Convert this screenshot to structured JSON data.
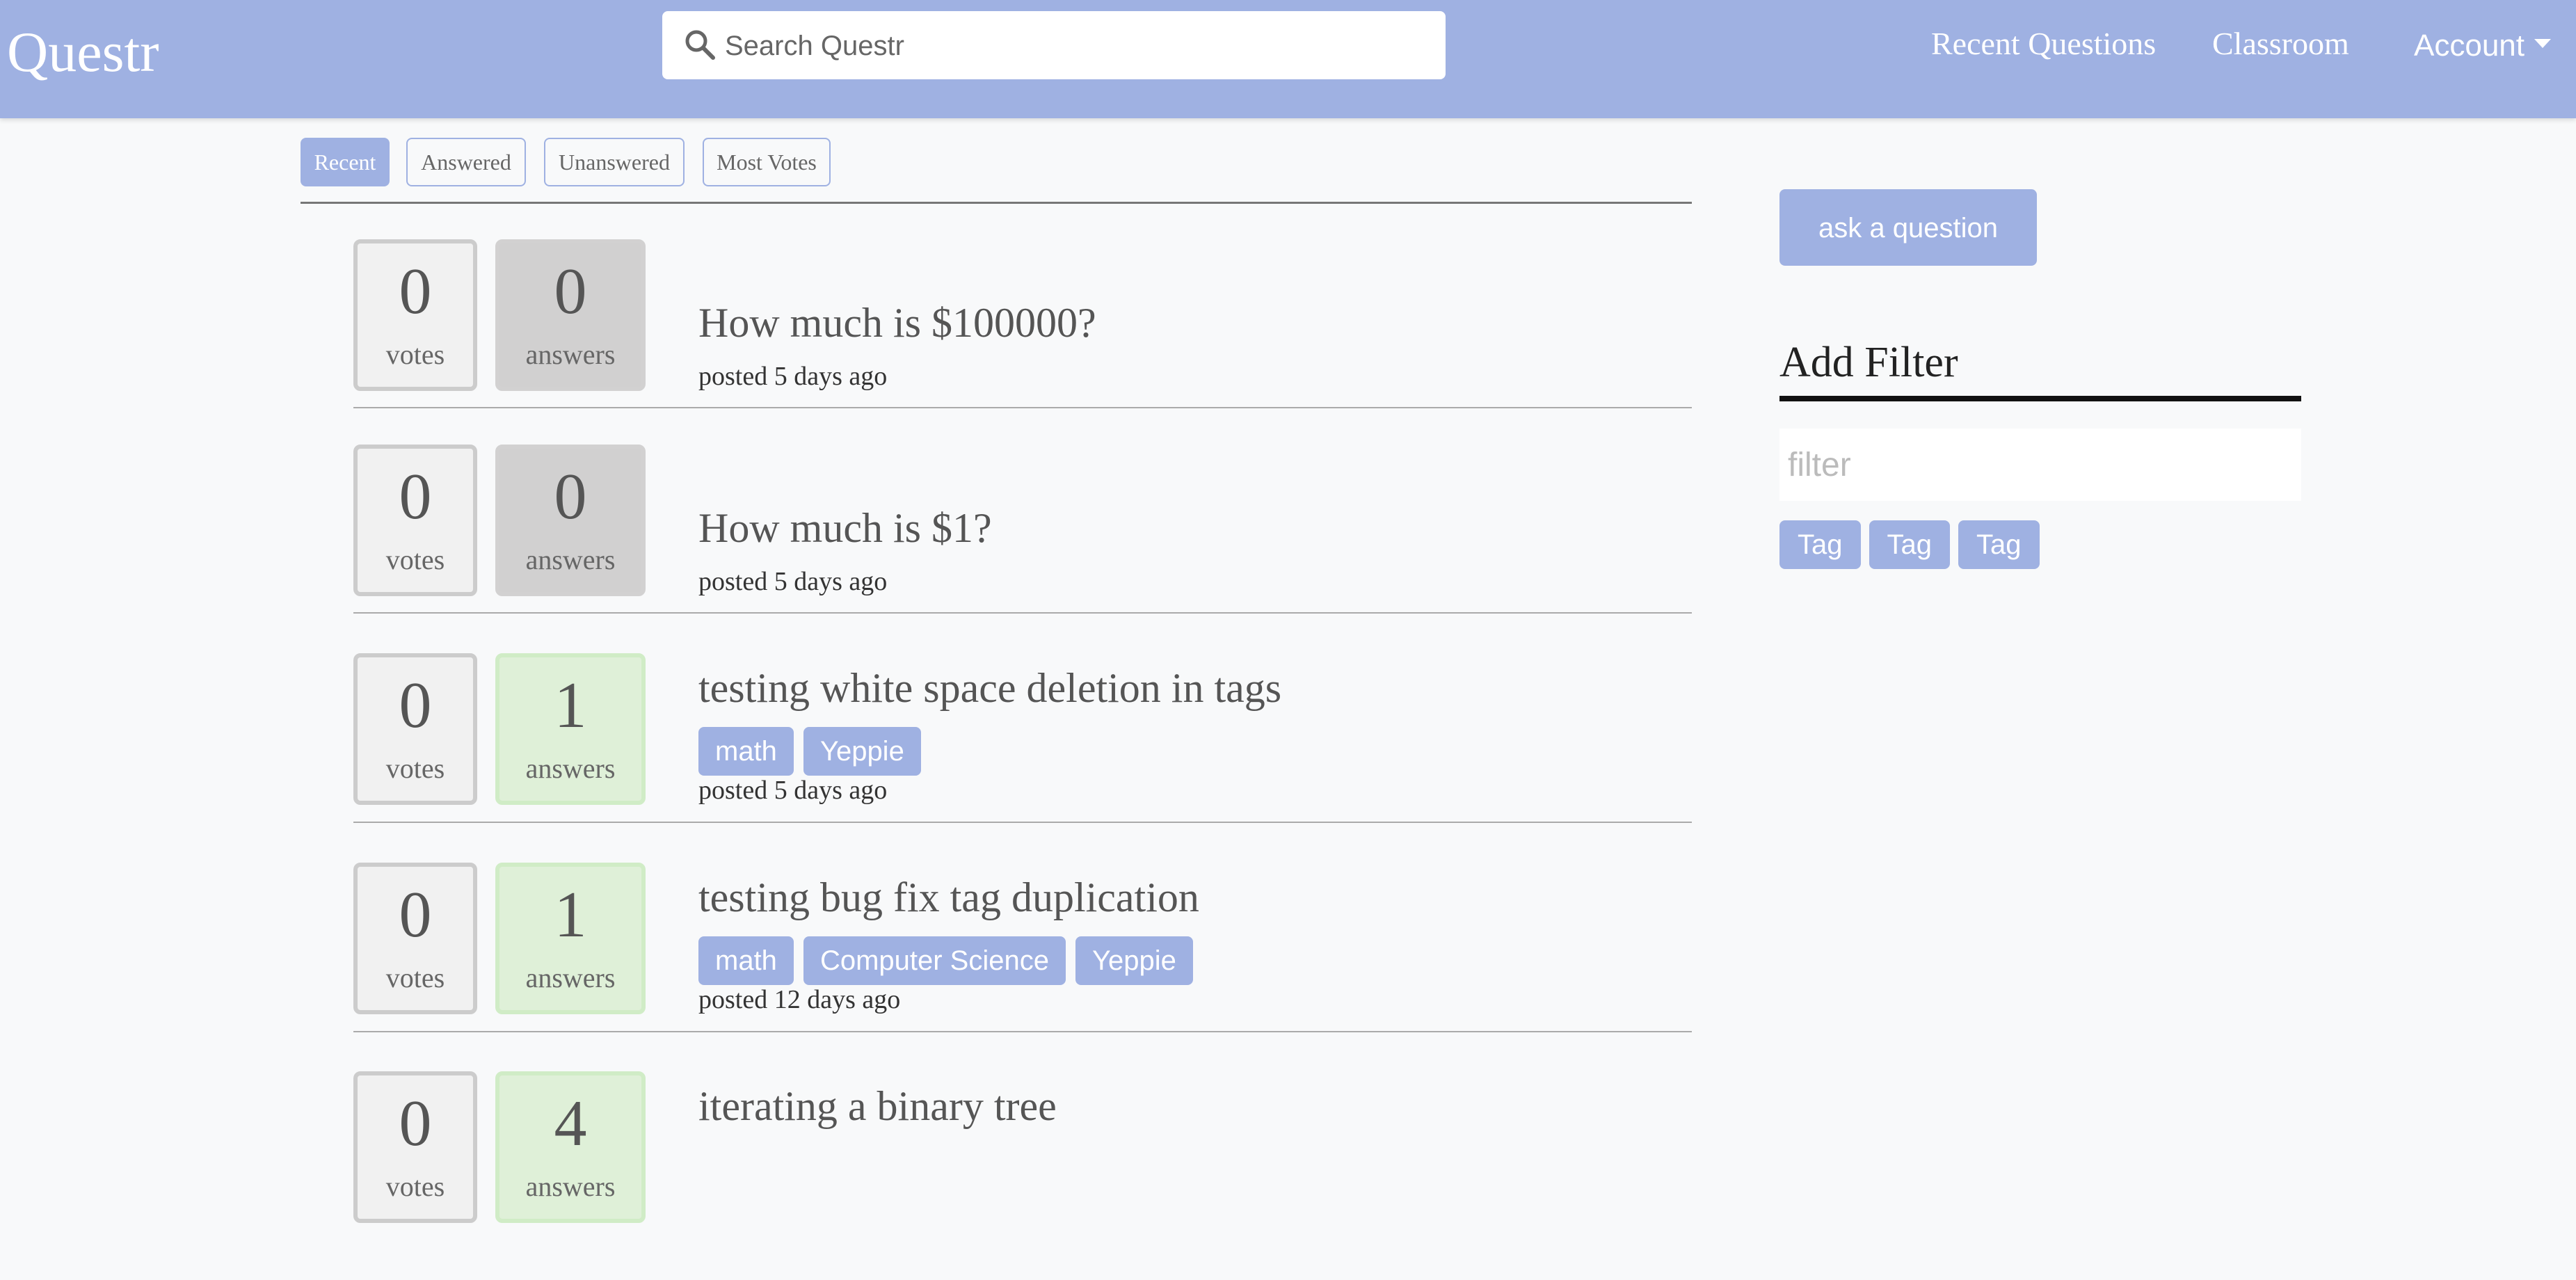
{
  "navbar": {
    "brand": "Questr",
    "search_placeholder": "Search Questr",
    "links": {
      "recent": "Recent Questions",
      "classroom": "Classroom",
      "account": "Account"
    }
  },
  "sort_tabs": {
    "recent": "Recent",
    "answered": "Answered",
    "unanswered": "Unanswered",
    "most_votes": "Most Votes",
    "active": "Recent"
  },
  "questions": [
    {
      "votes": "0",
      "votes_label": "votes",
      "answers": "0",
      "answers_label": "answers",
      "title": "How much is $100000?",
      "tags": [],
      "posted": "posted 5 days ago"
    },
    {
      "votes": "0",
      "votes_label": "votes",
      "answers": "0",
      "answers_label": "answers",
      "title": "How much is $1?",
      "tags": [],
      "posted": "posted 5 days ago"
    },
    {
      "votes": "0",
      "votes_label": "votes",
      "answers": "1",
      "answers_label": "answers",
      "title": "testing white space deletion in tags",
      "tags": [
        "math",
        "Yeppie"
      ],
      "posted": "posted 5 days ago"
    },
    {
      "votes": "0",
      "votes_label": "votes",
      "answers": "1",
      "answers_label": "answers",
      "title": "testing bug fix tag duplication",
      "tags": [
        "math",
        "Computer Science",
        "Yeppie"
      ],
      "posted": "posted 12 days ago"
    },
    {
      "votes": "0",
      "votes_label": "votes",
      "answers": "4",
      "answers_label": "answers",
      "title": "iterating a binary tree",
      "tags": [],
      "posted": ""
    }
  ],
  "sidebar": {
    "ask_button": "ask a question",
    "filter_heading": "Add Filter",
    "filter_placeholder": "filter",
    "filter_tags": [
      "Tag",
      "Tag",
      "Tag"
    ]
  },
  "colors": {
    "accent": "#9fb1e2",
    "answered_bg": "#dff0d8",
    "unanswered_bg": "#d1d0d0",
    "page_bg": "#f8f9fa"
  }
}
